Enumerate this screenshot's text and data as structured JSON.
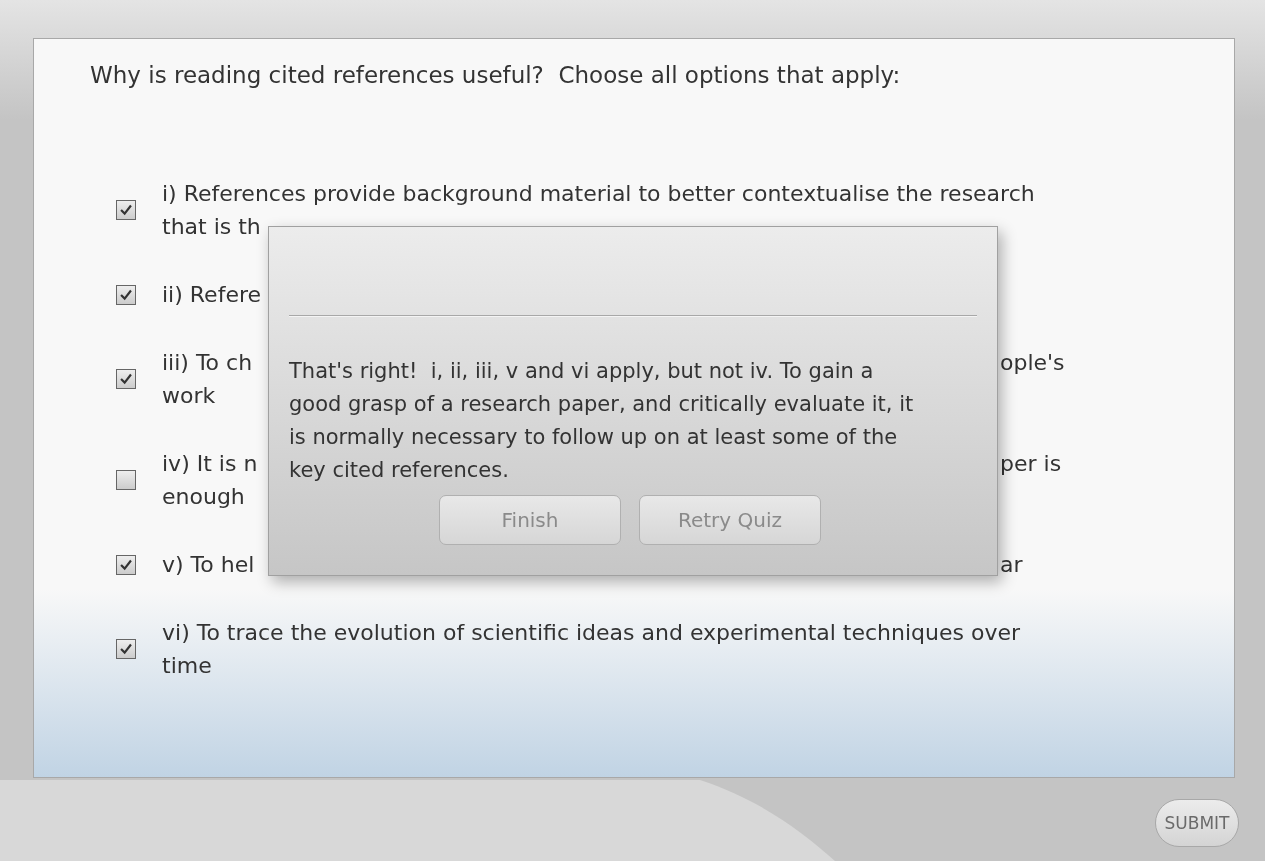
{
  "question": "Why is reading cited references useful?  Choose all options that apply:",
  "options": [
    {
      "checked": true,
      "lines": [
        {
          "left": "i) References provide background material to better contextualise the research"
        },
        {
          "left": "that is th"
        }
      ]
    },
    {
      "checked": true,
      "lines": [
        {
          "left": "ii) Refere"
        }
      ]
    },
    {
      "checked": true,
      "lines": [
        {
          "left": "iii) To ch",
          "right": "ople's"
        },
        {
          "left": "work"
        }
      ]
    },
    {
      "checked": false,
      "lines": [
        {
          "left": "iv) It is n",
          "right": "per is"
        },
        {
          "left": "enough"
        }
      ]
    },
    {
      "checked": true,
      "lines": [
        {
          "left": "v) To hel",
          "right": "ar"
        }
      ]
    },
    {
      "checked": true,
      "lines": [
        {
          "left": "vi) To trace the evolution of scientific ideas and experimental techniques over"
        },
        {
          "left": "time"
        }
      ]
    }
  ],
  "dialog": {
    "message": "That's right!  i, ii, iii, v and vi apply, but not iv. To gain a good grasp of a research paper, and critically evaluate it, it is normally necessary to follow up on at least some of the key cited references.",
    "buttons": [
      "Finish",
      "Retry Quiz"
    ]
  },
  "submit": "SUBMIT"
}
